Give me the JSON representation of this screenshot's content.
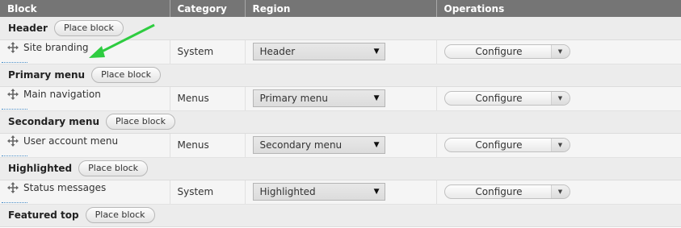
{
  "headers": {
    "block": "Block",
    "category": "Category",
    "region": "Region",
    "operations": "Operations"
  },
  "place_label": "Place block",
  "select_arrow": "▼",
  "toggle_arrow": "▼",
  "icons": {
    "drag": "move-arrows-icon"
  },
  "annotation_color": "#2ecc40",
  "regions": [
    {
      "title": "Header",
      "blocks": [
        {
          "label": "Site branding",
          "category": "System",
          "region": "Header",
          "operation": "Configure"
        }
      ]
    },
    {
      "title": "Primary menu",
      "blocks": [
        {
          "label": "Main navigation",
          "category": "Menus",
          "region": "Primary menu",
          "operation": "Configure"
        }
      ]
    },
    {
      "title": "Secondary menu",
      "blocks": [
        {
          "label": "User account menu",
          "category": "Menus",
          "region": "Secondary menu",
          "operation": "Configure"
        }
      ]
    },
    {
      "title": "Highlighted",
      "blocks": [
        {
          "label": "Status messages",
          "category": "System",
          "region": "Highlighted",
          "operation": "Configure"
        }
      ]
    },
    {
      "title": "Featured top",
      "blocks": []
    }
  ]
}
